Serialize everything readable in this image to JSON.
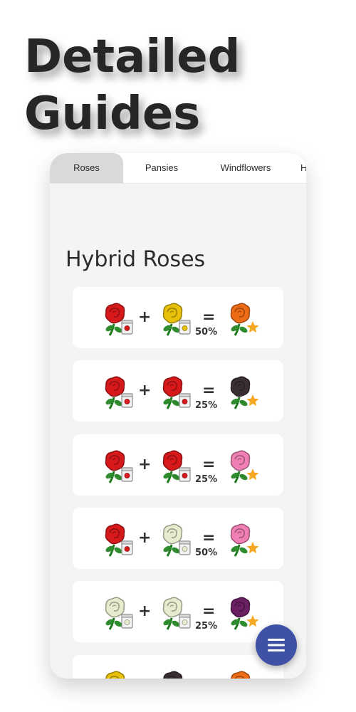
{
  "headline": {
    "line1": "Detailed",
    "line2": "Guides"
  },
  "tabs": [
    {
      "label": "Roses",
      "active": true
    },
    {
      "label": "Pansies",
      "active": false
    },
    {
      "label": "Windflowers",
      "active": false
    },
    {
      "label": "Hy",
      "active": false
    }
  ],
  "section_title": "Hybrid Roses",
  "operators": {
    "plus": "+",
    "equals": "="
  },
  "colors": {
    "red": "#d7191c",
    "yellow": "#e8c20a",
    "orange": "#ef6c17",
    "black": "#3a2e35",
    "pink": "#ef7fb4",
    "white": "#e6edcf",
    "purple": "#6b1f63",
    "fab": "#3f51a5",
    "star": "#f7a823"
  },
  "recipes": [
    {
      "parent_a": "red",
      "parent_b": "yellow",
      "result": "orange",
      "chance": "50%"
    },
    {
      "parent_a": "red",
      "parent_b": "red",
      "result": "black",
      "chance": "25%"
    },
    {
      "parent_a": "red",
      "parent_b": "red",
      "result": "pink",
      "chance": "25%"
    },
    {
      "parent_a": "red",
      "parent_b": "white",
      "result": "pink",
      "chance": "50%"
    },
    {
      "parent_a": "white",
      "parent_b": "white",
      "result": "purple",
      "chance": "25%"
    },
    {
      "parent_a": "yellow",
      "parent_b": "black",
      "result": "orange",
      "chance": ""
    }
  ],
  "icons": {
    "parent_badge": "seed-bag-icon",
    "result_badge": "star-icon",
    "fab": "menu-icon"
  }
}
